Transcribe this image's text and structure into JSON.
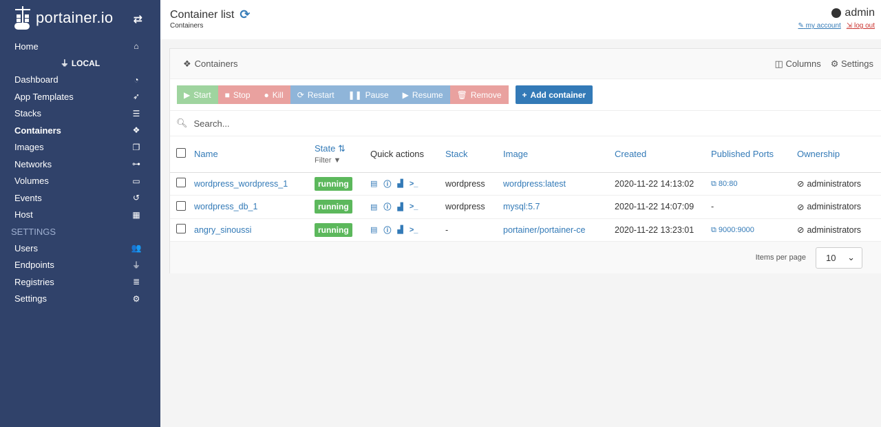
{
  "app": {
    "brand": "portainer.io"
  },
  "sidebar": {
    "home": "Home",
    "endpoint": "LOCAL",
    "items": [
      {
        "label": "Dashboard",
        "icon": "tachometer-icon"
      },
      {
        "label": "App Templates",
        "icon": "rocket-icon"
      },
      {
        "label": "Stacks",
        "icon": "th-list-icon"
      },
      {
        "label": "Containers",
        "icon": "cubes-icon"
      },
      {
        "label": "Images",
        "icon": "clone-icon"
      },
      {
        "label": "Networks",
        "icon": "sitemap-icon"
      },
      {
        "label": "Volumes",
        "icon": "hdd-icon"
      },
      {
        "label": "Events",
        "icon": "history-icon"
      },
      {
        "label": "Host",
        "icon": "th-icon"
      }
    ],
    "settings_heading": "SETTINGS",
    "settings_items": [
      {
        "label": "Users",
        "icon": "users-icon"
      },
      {
        "label": "Endpoints",
        "icon": "plug-icon"
      },
      {
        "label": "Registries",
        "icon": "database-icon"
      },
      {
        "label": "Settings",
        "icon": "cogs-icon"
      }
    ]
  },
  "header": {
    "title": "Container list",
    "breadcrumb": "Containers",
    "user": "admin",
    "my_account": "my account",
    "log_out": "log out"
  },
  "panel": {
    "title": "Containers",
    "columns_label": "Columns",
    "settings_label": "Settings",
    "buttons": {
      "start": "Start",
      "stop": "Stop",
      "kill": "Kill",
      "restart": "Restart",
      "pause": "Pause",
      "resume": "Resume",
      "remove": "Remove",
      "add": "Add container"
    },
    "search_placeholder": "Search...",
    "table": {
      "headers": {
        "name": "Name",
        "state": "State",
        "filter": "Filter",
        "quick_actions": "Quick actions",
        "stack": "Stack",
        "image": "Image",
        "created": "Created",
        "ports": "Published Ports",
        "ownership": "Ownership"
      },
      "rows": [
        {
          "name": "wordpress_wordpress_1",
          "state": "running",
          "stack": "wordpress",
          "image": "wordpress:latest",
          "created": "2020-11-22 14:13:02",
          "ports": "80:80",
          "ownership": "administrators"
        },
        {
          "name": "wordpress_db_1",
          "state": "running",
          "stack": "wordpress",
          "image": "mysql:5.7",
          "created": "2020-11-22 14:07:09",
          "ports": "-",
          "ownership": "administrators"
        },
        {
          "name": "angry_sinoussi",
          "state": "running",
          "stack": "-",
          "image": "portainer/portainer-ce",
          "created": "2020-11-22 13:23:01",
          "ports": "9000:9000",
          "ownership": "administrators"
        }
      ]
    },
    "pagination": {
      "label": "Items per page",
      "value": "10"
    }
  }
}
